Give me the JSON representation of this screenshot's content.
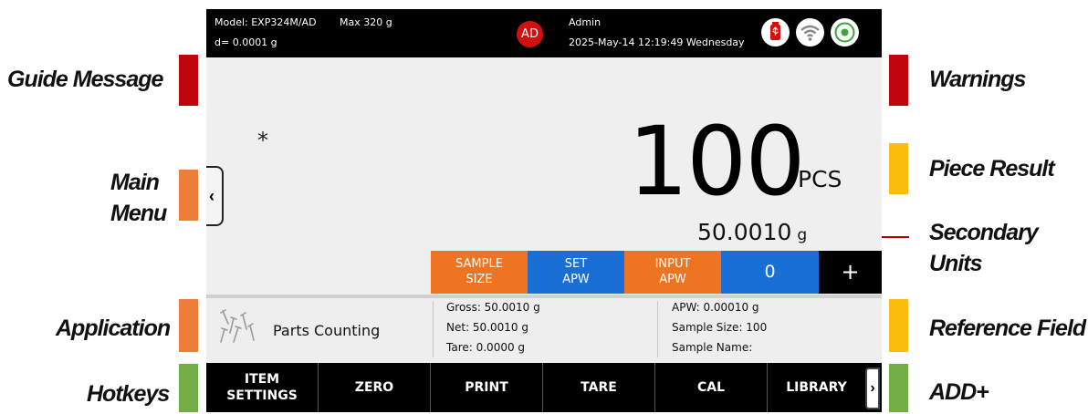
{
  "callouts": {
    "guide_message": "Guide Message",
    "main_menu_1": "Main",
    "main_menu_2": "Menu",
    "application": "Application",
    "hotkeys": "Hotkeys",
    "warnings": "Warnings",
    "piece_result": "Piece Result",
    "secondary_1": "Secondary",
    "secondary_2": "Units",
    "reference_field": "Reference Field",
    "add_plus": "ADD+"
  },
  "colors": {
    "red": "#c0060b",
    "orange": "#ef7d3a",
    "yellow": "#fbbd0c",
    "green": "#72ae45",
    "key_orange": "#ef7422",
    "key_blue": "#1a6fd6"
  },
  "status_bar": {
    "model": "Model: EXP324M/AD",
    "max": "Max 320 g",
    "readability": "d= 0.0001 g",
    "user_initials": "AD",
    "user_name": "Admin",
    "datetime": "2025-May-14 12:19:49 Wednesday",
    "icons": [
      "usb-icon",
      "wifi-icon",
      "level-icon"
    ]
  },
  "main_menu": {
    "icon": "chevron-left-icon",
    "glyph": "‹"
  },
  "stability_mark": "*",
  "result": {
    "value": "100",
    "unit": "PCS",
    "secondary_value": "50.0010",
    "secondary_unit": "g"
  },
  "function_keys": {
    "sample_size": [
      "SAMPLE",
      "SIZE"
    ],
    "set_apw": [
      "SET",
      "APW"
    ],
    "input_apw": [
      "INPUT",
      "APW"
    ],
    "counter": "0",
    "plus": "+"
  },
  "application": {
    "icon": "parts-counting-icon",
    "name": "Parts Counting"
  },
  "reference": {
    "gross": "Gross: 50.0010 g",
    "net": "Net: 50.0010 g",
    "tare": "Tare: 0.0000 g",
    "apw": "APW: 0.00010 g",
    "sample_size": "Sample Size: 100",
    "sample_name": "Sample Name:"
  },
  "hotkeys": {
    "item_settings": [
      "ITEM",
      "SETTINGS"
    ],
    "zero": "ZERO",
    "print": "PRINT",
    "tare": "TARE",
    "cal": "CAL",
    "library": "LIBRARY",
    "add_glyph": "›"
  }
}
